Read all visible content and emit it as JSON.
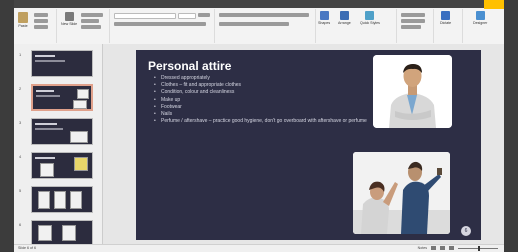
{
  "ribbon": {
    "buttons": [
      {
        "label": "Paste",
        "color": "#c0a060"
      },
      {
        "label": "New Slide",
        "color": "#7a7a7a"
      },
      {
        "label": "Shapes",
        "color": "#4a78c2"
      },
      {
        "label": "Arrange",
        "color": "#3c6db4"
      },
      {
        "label": "Quick Styles",
        "color": "#4fa0c8"
      },
      {
        "label": "Find",
        "color": "#6a6a6a"
      },
      {
        "label": "Dictate",
        "color": "#3a6fc0"
      },
      {
        "label": "Designer",
        "color": "#4a8fd0"
      }
    ],
    "groups": [
      "Clipboard",
      "Slides",
      "Font",
      "Paragraph",
      "Drawing",
      "Editing",
      "Voice",
      "Designer"
    ]
  },
  "thumbnails": [
    {
      "num": "1"
    },
    {
      "num": "2"
    },
    {
      "num": "3"
    },
    {
      "num": "4"
    },
    {
      "num": "5"
    },
    {
      "num": "6"
    }
  ],
  "slide": {
    "title": "Personal attire",
    "bullets": [
      "Dressed appropriately",
      "Clothes – fit and appropriate clothes",
      "Condition, colour and cleanliness",
      "Make up",
      "Footwear",
      "Nails",
      "Perfume / aftershave – practice good hygiene, don't go overboard with aftershave or perfume"
    ],
    "footer": "",
    "number": "6"
  },
  "status": {
    "left": "Slide 6 of 6",
    "notes": "Notes",
    "zoom": "—"
  },
  "colors": {
    "slide_bg": "#2d2e45",
    "selected_thumb_border": "#e0a18b",
    "accent_tab": "#ffc000"
  }
}
